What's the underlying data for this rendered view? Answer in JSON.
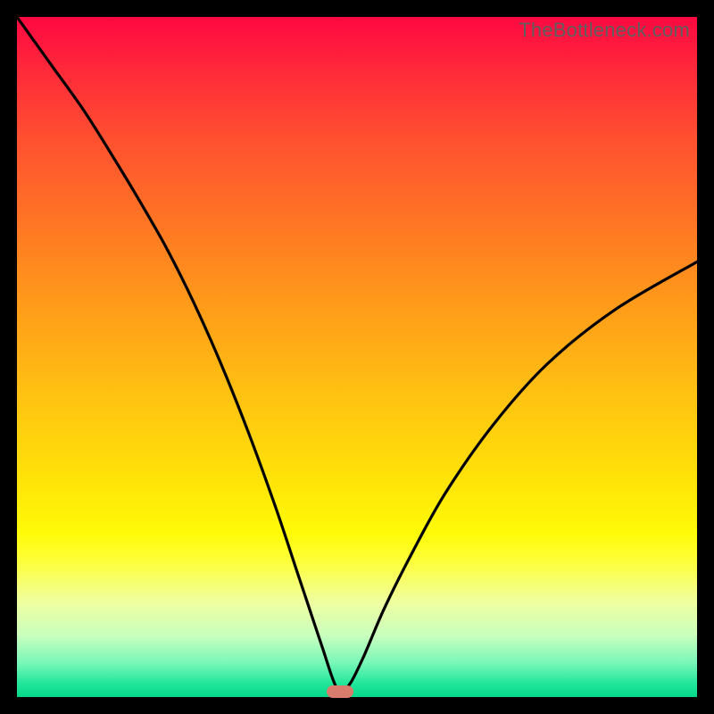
{
  "watermark": "TheBottleneck.com",
  "marker": {
    "x_pct": 47.5,
    "y_pct": 99.2
  },
  "colors": {
    "curve": "#000000",
    "marker": "#d87c6e",
    "frame": "#000000"
  },
  "chart_data": {
    "type": "line",
    "title": "",
    "xlabel": "",
    "ylabel": "",
    "xlim": [
      0,
      100
    ],
    "ylim": [
      0,
      100
    ],
    "grid": false,
    "legend": false,
    "note": "x and y expressed as percentages of the plot area; y=0 is bottom, y=100 is top",
    "series": [
      {
        "name": "bottleneck-curve",
        "x": [
          0,
          5,
          10,
          15,
          18,
          22,
          26,
          30,
          34,
          38,
          41,
          43,
          45,
          46.5,
          47.5,
          49,
          51,
          54,
          58,
          63,
          70,
          78,
          88,
          100
        ],
        "y": [
          100,
          93,
          86,
          78,
          73,
          66,
          58,
          49,
          39,
          28,
          19,
          13,
          7,
          2.5,
          0.8,
          2,
          6,
          13,
          21,
          30,
          40,
          49,
          57,
          64
        ]
      }
    ],
    "marker_point": {
      "x": 47.5,
      "y": 0.8
    }
  }
}
